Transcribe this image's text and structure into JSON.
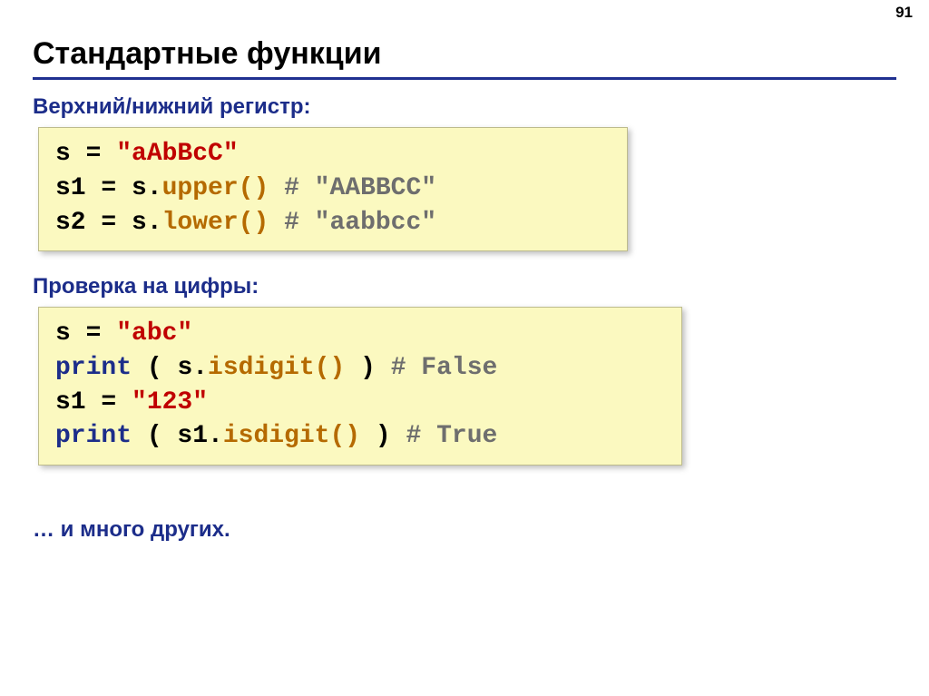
{
  "page_number": "91",
  "title": "Стандартные функции",
  "section_upper_lower": "Верхний/нижний регистр:",
  "section_digits": "Проверка на цифры:",
  "section_more": "… и много других.",
  "code1": {
    "l1_a": "s = ",
    "l1_b": "\"aAbBcC\"",
    "l2_a": "s1 = s.",
    "l2_b": "upper()",
    "l2_c": "   ",
    "l2_d": "# \"AABBCC\"",
    "l3_a": "s2 = s.",
    "l3_b": "lower()",
    "l3_c": "   ",
    "l3_d": "# \"aabbcc\""
  },
  "code2": {
    "l1_a": "s = ",
    "l1_b": "\"abc\"",
    "l2_a": "print",
    "l2_b": " ( ",
    "l2_c": " s.",
    "l2_d": "isdigit()",
    "l2_e": " )   ",
    "l2_f": "# False",
    "l3_a": "s1 = ",
    "l3_b": "\"123\"",
    "l4_a": "print",
    "l4_b": " ( s1.",
    "l4_c": "isdigit()",
    "l4_d": " )  ",
    "l4_e": "# True"
  }
}
